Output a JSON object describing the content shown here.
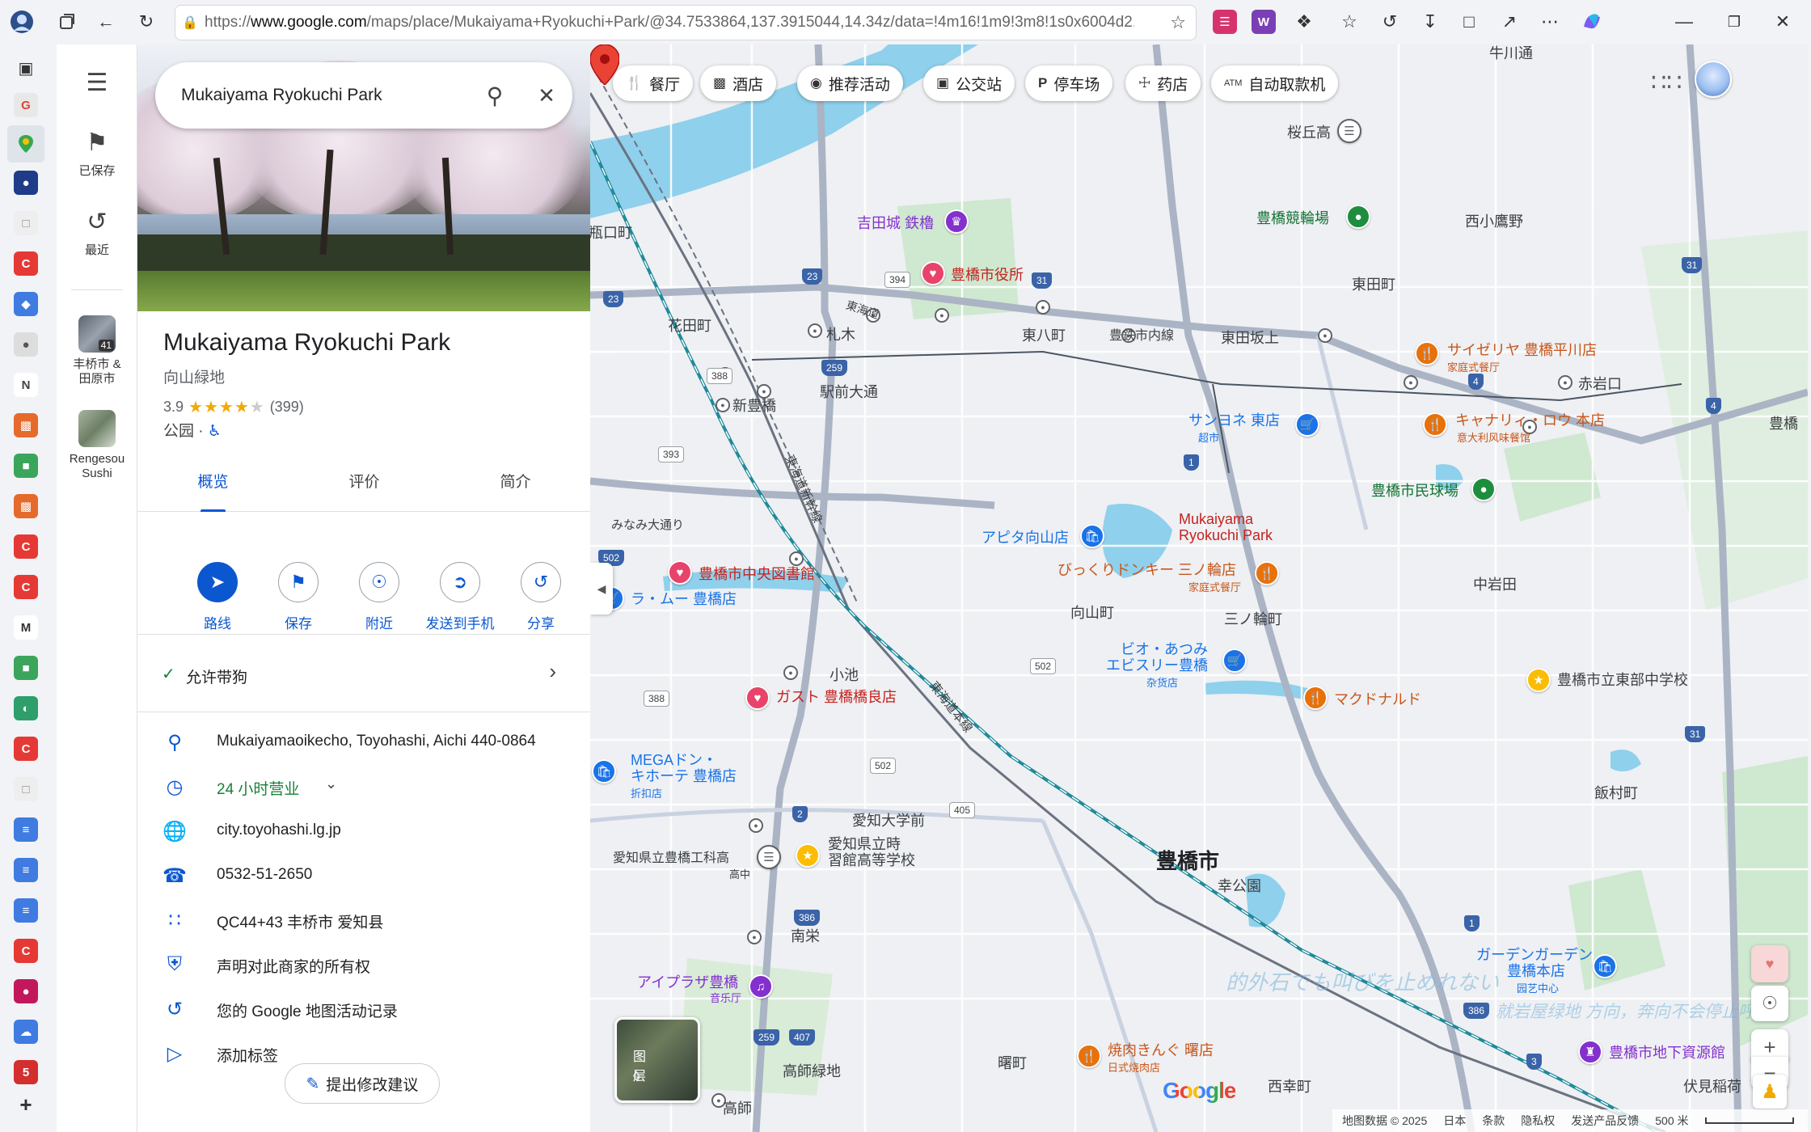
{
  "browser": {
    "url_prefix": "https://",
    "url_domain": "www.google.com",
    "url_rest": "/maps/place/Mukaiyama+Ryokuchi+Park/@34.7533864,137.3915044,14.34z/data=!4m16!1m9!3m8!1s0x6004d2..."
  },
  "rail": {
    "saved": "已保存",
    "recent": "最近",
    "thumb1_badge": "41",
    "thumb1_label": "丰桥市 & 田原市",
    "thumb2_label": "Rengesou Sushi"
  },
  "panel": {
    "search_value": "Mukaiyama Ryokuchi Park",
    "title": "Mukaiyama Ryokuchi Park",
    "subtitle": "向山緑地",
    "rating": "3.9",
    "reviews": "(399)",
    "category": "公园 · ",
    "tabs": [
      "概览",
      "评价",
      "简介"
    ],
    "actions": [
      "路线",
      "保存",
      "附近",
      "发送到手机",
      "分享"
    ],
    "dog": "允许带狗",
    "address": "Mukaiyamaoikecho, Toyohashi, Aichi 440-0864",
    "hours": "24 小时营业",
    "website": "city.toyohashi.lg.jp",
    "phone": "0532-51-2650",
    "pluscode": "QC44+43 丰桥市 爱知县",
    "claim": "声明对此商家的所有权",
    "activity": "您的 Google 地图活动记录",
    "label": "添加标签",
    "suggest": "提出修改建议"
  },
  "map": {
    "chips": [
      "餐厅",
      "酒店",
      "推荐活动",
      "公交站",
      "停车场",
      "药店",
      "自动取款机"
    ],
    "layers": "图层",
    "google": "Google",
    "attrib": [
      "地图数据 © 2025",
      "日本",
      "条款",
      "隐私权",
      "发送产品反馈",
      "500 米"
    ],
    "labels": {
      "park_name_1": "Mukaiyama",
      "park_name_2": "Ryokuchi Park",
      "city": "豊橋市",
      "yoshida": "吉田城 鉄櫓",
      "cityhall": "豊橋市役所",
      "keirin": "豊橋競輪場",
      "sakuragaoka": "桜丘高",
      "nishikomaba": "西小鷹野",
      "higashidacho": "東田町",
      "hanadacho": "花田町",
      "fudaki": "札木",
      "higashihatcho": "東八町",
      "toyotetsu": "豊鉄市内線",
      "higashidazaka": "東田坂上",
      "saizeriya": "サイゼリヤ 豊橋平川店",
      "saizeriya_sub": "家庭式餐厅",
      "akaiwaguchi": "赤岩口",
      "shintoyohashi": "新豊橋",
      "ekimae": "駅前大通",
      "sanyone": "サンヨネ 東店",
      "sanyone_sub": "超市",
      "capricciosa": "キャナリィ・ロウ 本店",
      "capricciosa_sub": "意大利风味餐馆",
      "minkyujo": "豊橋市民球場",
      "apita": "アピタ向山店",
      "donkey": "びっくりドンキー 三ノ輪店",
      "donkey_sub": "家庭式餐厅",
      "library": "豊橋市中央図書館",
      "ramu": "ラ・ムー 豊橋店",
      "mukaiyamacho": "向山町",
      "sannowacho": "三ノ輪町",
      "nakaiwata": "中岩田",
      "bio_1": "ビオ・あつみ",
      "bio_2": "エビスリー豊橋",
      "bio_sub": "杂货店",
      "koike": "小池",
      "gusto": "ガスト 豊橋橋良店",
      "mcd": "マクドナルド",
      "tobu": "豊橋市立東部中学校",
      "mega_1": "MEGAドン・",
      "mega_2": "キホーテ 豊橋店",
      "mega_sub": "折扣店",
      "iimuracho": "飯村町",
      "aichidaigaku": "愛知大学前",
      "kogyo": "愛知県立豊橋工科高",
      "kogyo_sub": "高中",
      "jishukan_1": "愛知県立時",
      "jishukan_2": "習館高等学校",
      "saiwai": "幸公園",
      "nansei": "南栄",
      "aiplaza": "アイプラザ豊橋",
      "aiplaza_sub": "音乐厅",
      "garden_1": "ガーデンガーデン",
      "garden_2": "豊橋本店",
      "garden_sub": "园艺中心",
      "yakiniku": "焼肉きんぐ 曙店",
      "yakiniku_sub": "日式烧肉店",
      "akebono": "曙町",
      "nishikocho": "西幸町",
      "takashi": "高師緑地",
      "takashi2": "高師",
      "underground": "豊橋市地下資源館",
      "fushimi": "伏見稲荷",
      "tokaido": "東海道",
      "tokaido_line": "東海道本線",
      "shinkansen": "東海道新幹線",
      "minami": "みなみ大通り",
      "iwata_edge": "豊橋",
      "nakaguchi": "瓶口町",
      "ushikawa": "牛川通",
      "overlay1": "的外石でも叫びを止めれない",
      "overlay2": "就岩屋绿地 方向，奔向不会停止呼喚"
    }
  }
}
